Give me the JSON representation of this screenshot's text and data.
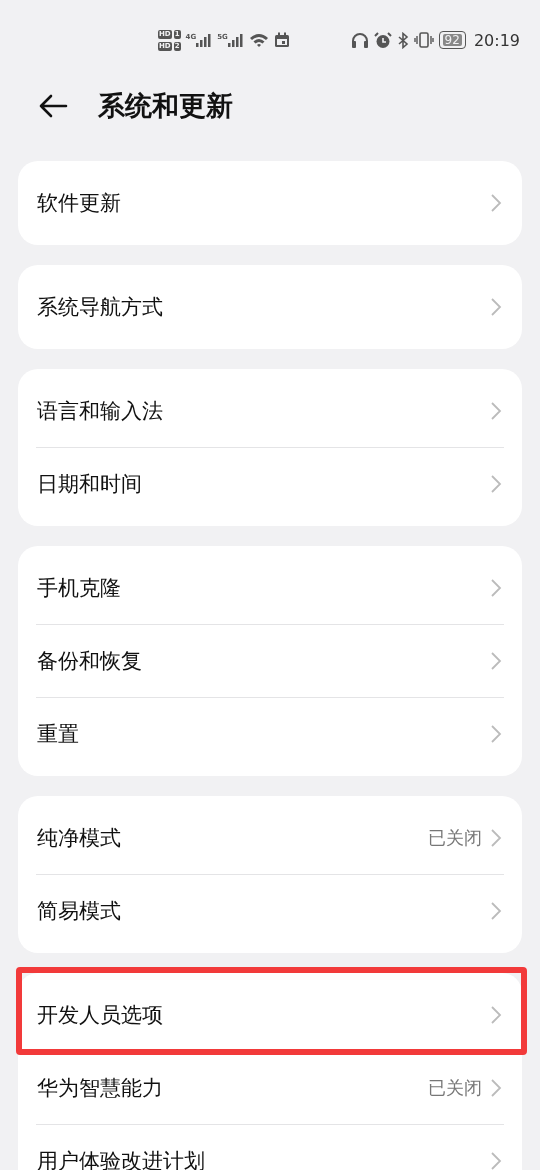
{
  "status_bar": {
    "sims": [
      {
        "badge": "HD",
        "slot": "1"
      },
      {
        "badge": "HD",
        "slot": "2"
      }
    ],
    "networks": [
      "4G",
      "5G"
    ],
    "battery": "92",
    "time": "20:19"
  },
  "header": {
    "title": "系统和更新"
  },
  "groups": [
    {
      "items": [
        {
          "label": "软件更新",
          "highlighted": false
        }
      ]
    },
    {
      "items": [
        {
          "label": "系统导航方式",
          "highlighted": false
        }
      ]
    },
    {
      "items": [
        {
          "label": "语言和输入法",
          "highlighted": false
        },
        {
          "label": "日期和时间",
          "highlighted": false
        }
      ]
    },
    {
      "items": [
        {
          "label": "手机克隆",
          "highlighted": false
        },
        {
          "label": "备份和恢复",
          "highlighted": false
        },
        {
          "label": "重置",
          "highlighted": false
        }
      ]
    },
    {
      "items": [
        {
          "label": "纯净模式",
          "value": "已关闭",
          "highlighted": false
        },
        {
          "label": "简易模式",
          "highlighted": false
        }
      ]
    },
    {
      "items": [
        {
          "label": "开发人员选项",
          "highlighted": true
        },
        {
          "label": "华为智慧能力",
          "value": "已关闭",
          "highlighted": false
        },
        {
          "label": "用户体验改进计划",
          "highlighted": false
        }
      ]
    }
  ]
}
